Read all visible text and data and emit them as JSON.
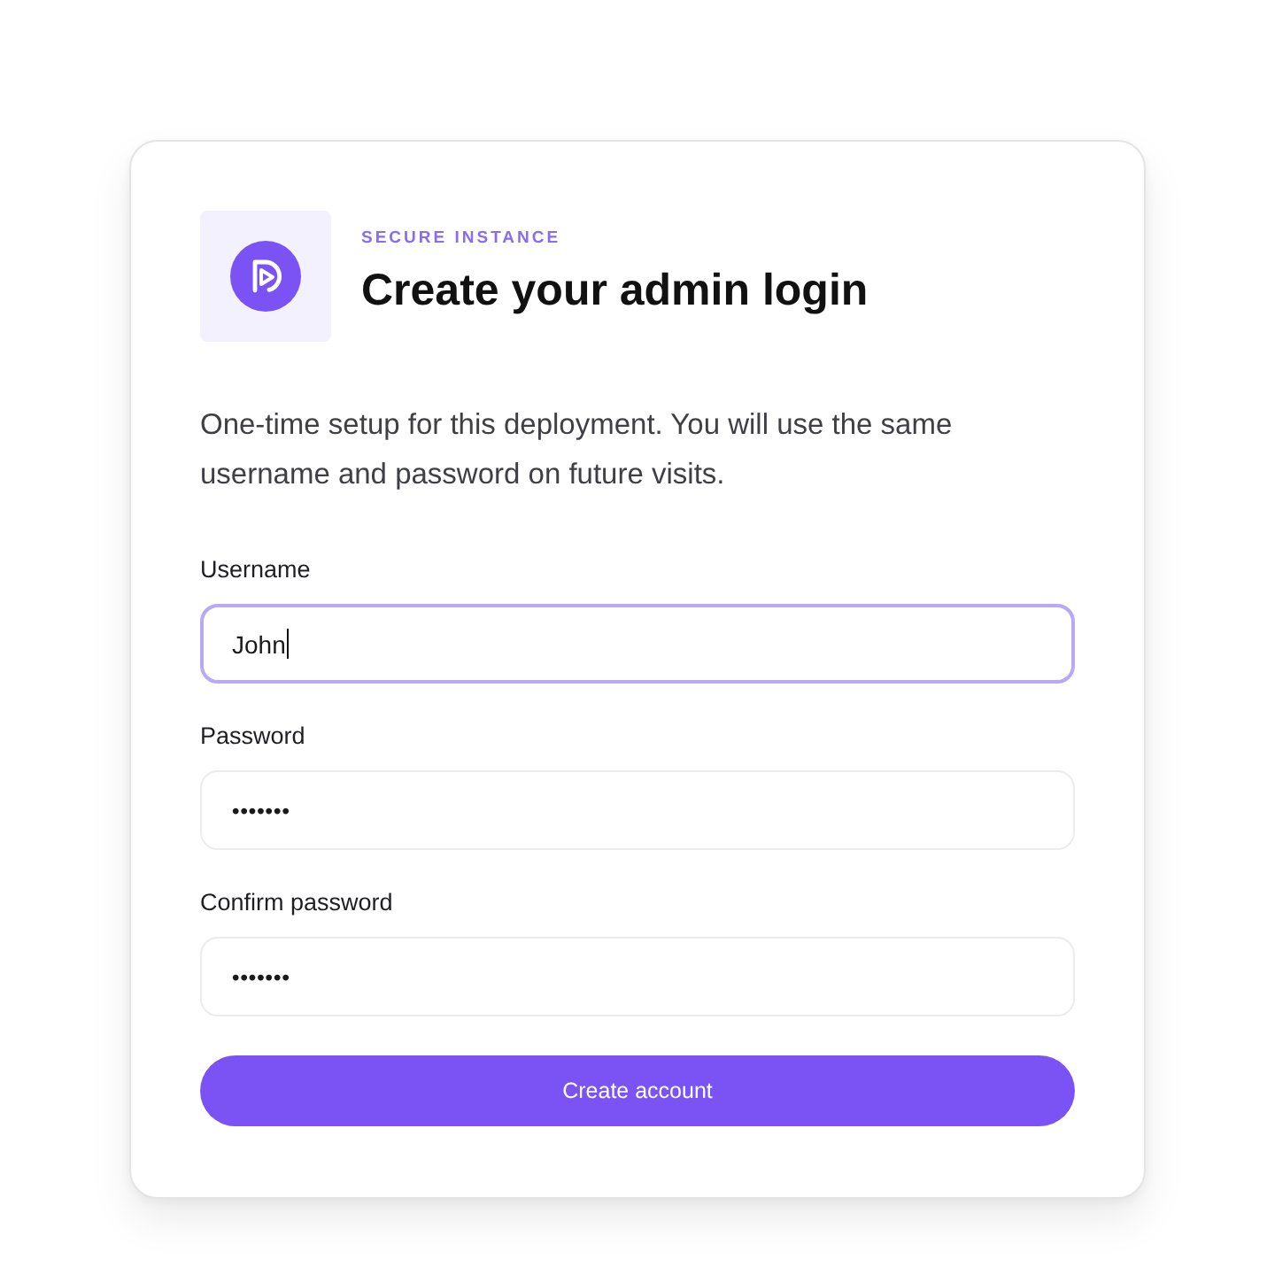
{
  "card": {
    "eyebrow": "SECURE INSTANCE",
    "title": "Create your admin login",
    "description": "One-time setup for this deployment. You will use the same username and password on future visits.",
    "fields": [
      {
        "kind": "text",
        "label": "Username",
        "value": "John",
        "focused": true
      },
      {
        "kind": "password",
        "label": "Password",
        "value": "•••••••",
        "focused": false
      },
      {
        "kind": "password",
        "label": "Confirm password",
        "value": "•••••••",
        "focused": false
      }
    ],
    "submit_button": {
      "label": "Create account"
    }
  }
}
